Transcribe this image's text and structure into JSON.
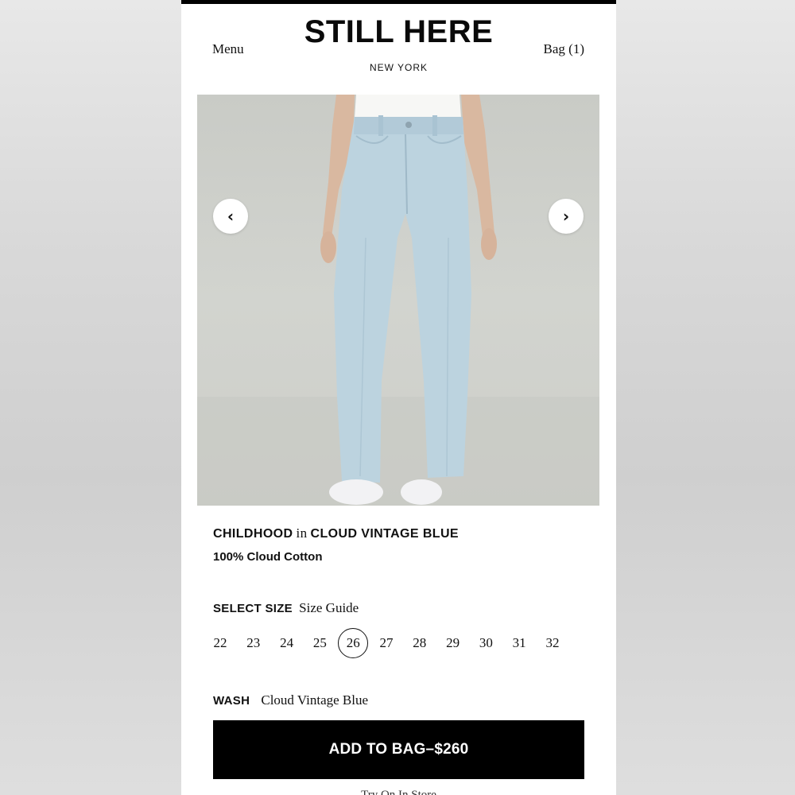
{
  "header": {
    "menu_label": "Menu",
    "brand": "STILL HERE",
    "city": "NEW YORK",
    "bag_label": "Bag (1)"
  },
  "gallery": {
    "prev_icon": "chevron-left-icon",
    "next_icon": "chevron-right-icon",
    "prev_glyph": "‹",
    "next_glyph": "›"
  },
  "product": {
    "name": "CHILDHOOD",
    "connector": "in",
    "color": "CLOUD VINTAGE BLUE",
    "material": "100% Cloud Cotton"
  },
  "size_selector": {
    "label": "SELECT SIZE",
    "guide_label": "Size Guide",
    "sizes": [
      "22",
      "23",
      "24",
      "25",
      "26",
      "27",
      "28",
      "29",
      "30",
      "31",
      "32"
    ],
    "selected": "26"
  },
  "wash": {
    "label": "WASH",
    "value": "Cloud Vintage Blue"
  },
  "cta": {
    "add_to_bag_label": "ADD TO BAG–$260"
  },
  "footer": {
    "cutoff_text": "Try On In Store"
  },
  "colors": {
    "button_bg": "#000000",
    "denim": "#bcd3df",
    "background": "#ffffff"
  }
}
